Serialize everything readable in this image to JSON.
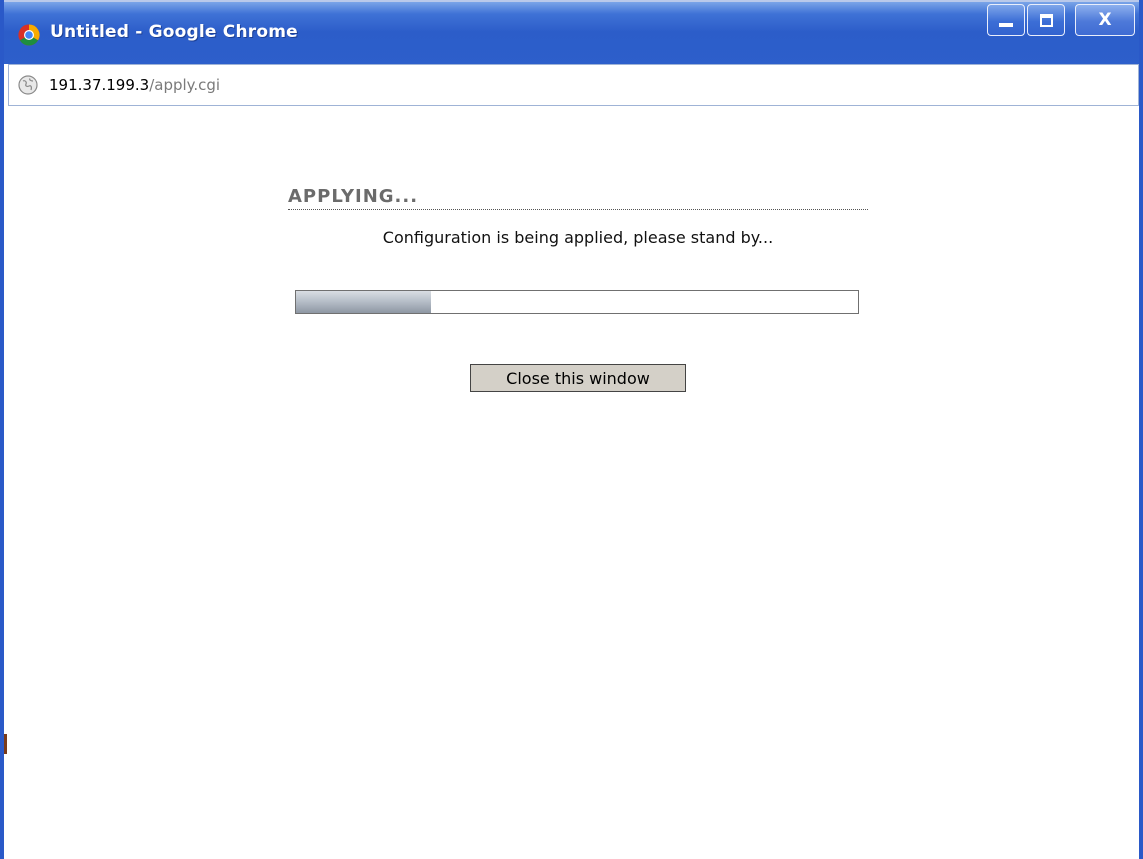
{
  "window": {
    "title": "Untitled - Google Chrome",
    "controls": {
      "minimize": "minimize-icon",
      "maximize": "maximize-icon",
      "close": "X"
    }
  },
  "address_bar": {
    "host": "191.37.199.3",
    "path": "/apply.cgi",
    "icon": "globe-icon"
  },
  "page": {
    "heading": "APPLYING...",
    "message": "Configuration is being applied, please stand by...",
    "progress_fraction": 0.24,
    "close_button_label": "Close this window"
  },
  "colors": {
    "titlebar": "#2c5dc9",
    "heading": "#6b6b6b",
    "button_bg": "#d4d0c8"
  }
}
